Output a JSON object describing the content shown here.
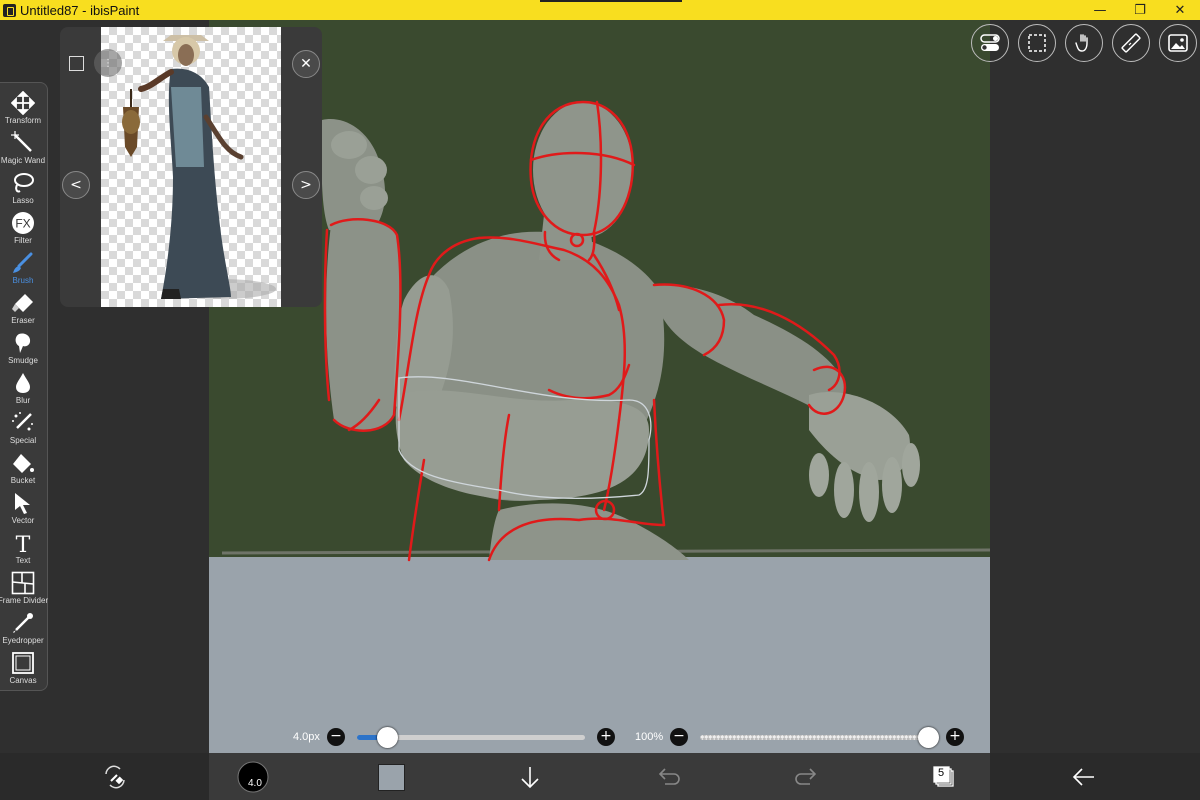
{
  "window": {
    "title": "Untitled87 - ibisPaint",
    "minimize_glyph": "—",
    "restore_glyph": "❐",
    "close_glyph": "✕"
  },
  "reference": {
    "close_glyph": "✕",
    "prev_glyph": "<",
    "next_glyph": ">"
  },
  "toolbar": {
    "active": "Brush",
    "tools": [
      {
        "label": "Transform",
        "icon": "move-arrows-icon"
      },
      {
        "label": "Magic Wand",
        "icon": "magic-wand-icon"
      },
      {
        "label": "Lasso",
        "icon": "lasso-icon"
      },
      {
        "label": "Filter",
        "icon": "fx-icon"
      },
      {
        "label": "Brush",
        "icon": "brush-icon"
      },
      {
        "label": "Eraser",
        "icon": "eraser-icon"
      },
      {
        "label": "Smudge",
        "icon": "smudge-icon"
      },
      {
        "label": "Blur",
        "icon": "drop-icon"
      },
      {
        "label": "Special",
        "icon": "special-pen-icon"
      },
      {
        "label": "Bucket",
        "icon": "bucket-icon"
      },
      {
        "label": "Vector",
        "icon": "cursor-icon"
      },
      {
        "label": "Text",
        "icon": "text-icon"
      },
      {
        "label": "Frame Divider",
        "icon": "frame-divider-icon"
      },
      {
        "label": "Eyedropper",
        "icon": "eyedropper-icon"
      },
      {
        "label": "Canvas",
        "icon": "canvas-icon"
      }
    ],
    "fx_text": "FX",
    "text_glyph": "T"
  },
  "top_buttons": [
    {
      "name": "toggle-settings-icon"
    },
    {
      "name": "selection-icon"
    },
    {
      "name": "hand-gesture-icon"
    },
    {
      "name": "ruler-icon"
    },
    {
      "name": "material-image-icon"
    }
  ],
  "sliders": {
    "brush_size_label": "4.0px",
    "brush_size_fraction": 0.13,
    "opacity_label": "100%",
    "opacity_fraction": 1.0,
    "minus_glyph": "−",
    "plus_glyph": "+"
  },
  "bottom": {
    "brush_size_badge": "4.0",
    "layer_count": "5",
    "current_color": "#9aa3ab"
  },
  "colors": {
    "titlebar": "#f8de1f",
    "canvas_background": "#3a4a2f",
    "outline_red": "#e01a1a",
    "accent_blue": "#2c73c9"
  }
}
